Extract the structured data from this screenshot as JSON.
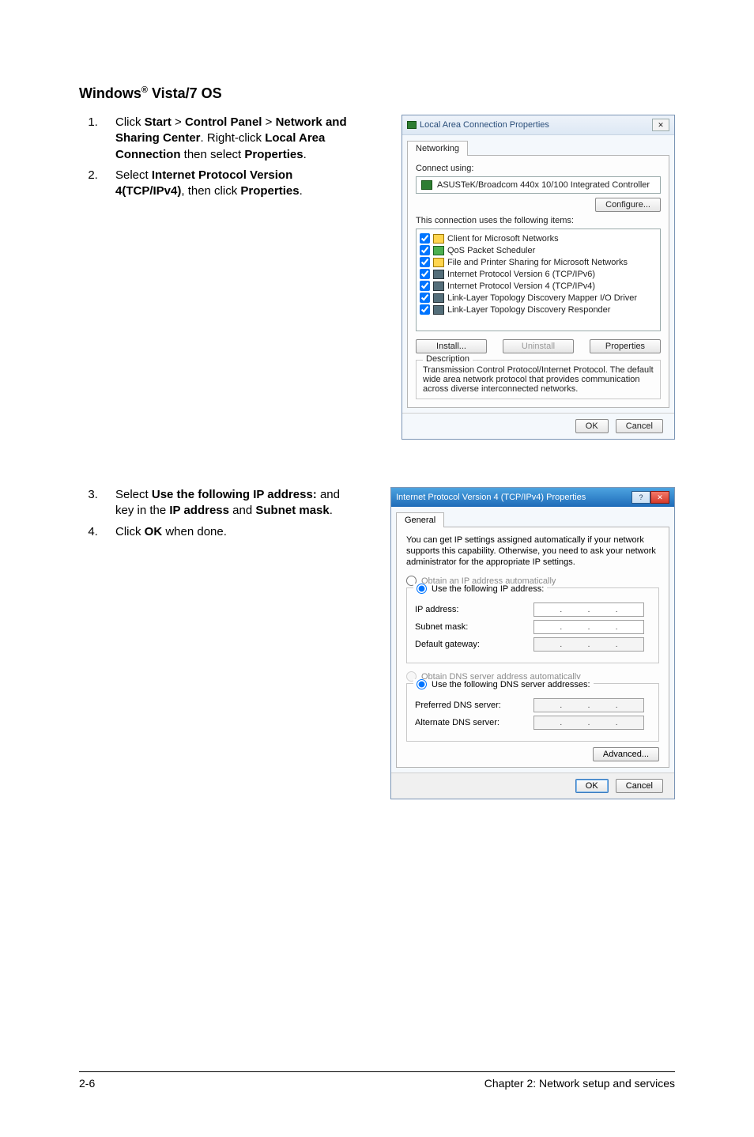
{
  "heading_prefix": "Windows",
  "heading_reg": "®",
  "heading_suffix": " Vista/7 OS",
  "steps_a": {
    "s1_a": "Click ",
    "s1_b": "Start",
    "s1_c": " > ",
    "s1_d": "Control Panel",
    "s1_e": " > ",
    "s1_f": "Network and Sharing Center",
    "s1_g": ". Right-click ",
    "s1_h": "Local Area Connection",
    "s1_i": " then select ",
    "s1_j": "Properties",
    "s1_k": ".",
    "s2_a": "Select ",
    "s2_b": "Internet Protocol Version 4(TCP/IPv4)",
    "s2_c": ", then click ",
    "s2_d": "Properties",
    "s2_e": "."
  },
  "steps_b": {
    "s3_a": "Select ",
    "s3_b": "Use the following IP address:",
    "s3_c": " and key in the ",
    "s3_d": "IP address",
    "s3_e": " and ",
    "s3_f": "Subnet mask",
    "s3_g": ".",
    "s4_a": "Click ",
    "s4_b": "OK",
    "s4_c": " when done."
  },
  "dlg1": {
    "title": "Local Area Connection Properties",
    "close": "✕",
    "tab": "Networking",
    "connect_using": "Connect using:",
    "adapter": "ASUSTeK/Broadcom 440x 10/100 Integrated Controller",
    "configure": "Configure...",
    "uses_label": "This connection uses the following items:",
    "items": [
      "Client for Microsoft Networks",
      "QoS Packet Scheduler",
      "File and Printer Sharing for Microsoft Networks",
      "Internet Protocol Version 6 (TCP/IPv6)",
      "Internet Protocol Version 4 (TCP/IPv4)",
      "Link-Layer Topology Discovery Mapper I/O Driver",
      "Link-Layer Topology Discovery Responder"
    ],
    "install": "Install...",
    "uninstall": "Uninstall",
    "properties": "Properties",
    "desc_label": "Description",
    "desc_text": "Transmission Control Protocol/Internet Protocol. The default wide area network protocol that provides communication across diverse interconnected networks.",
    "ok": "OK",
    "cancel": "Cancel"
  },
  "dlg2": {
    "title": "Internet Protocol Version 4 (TCP/IPv4) Properties",
    "help": "?",
    "close": "✕",
    "tab": "General",
    "intro": "You can get IP settings assigned automatically if your network supports this capability. Otherwise, you need to ask your network administrator for the appropriate IP settings.",
    "r_auto_ip": "Obtain an IP address automatically",
    "r_use_ip": "Use the following IP address:",
    "f_ip": "IP address:",
    "f_mask": "Subnet mask:",
    "f_gw": "Default gateway:",
    "r_auto_dns": "Obtain DNS server address automatically",
    "r_use_dns": "Use the following DNS server addresses:",
    "f_pdns": "Preferred DNS server:",
    "f_adns": "Alternate DNS server:",
    "advanced": "Advanced...",
    "ok": "OK",
    "cancel": "Cancel"
  },
  "footer": {
    "left": "2-6",
    "right": "Chapter 2:  Network setup and services"
  }
}
